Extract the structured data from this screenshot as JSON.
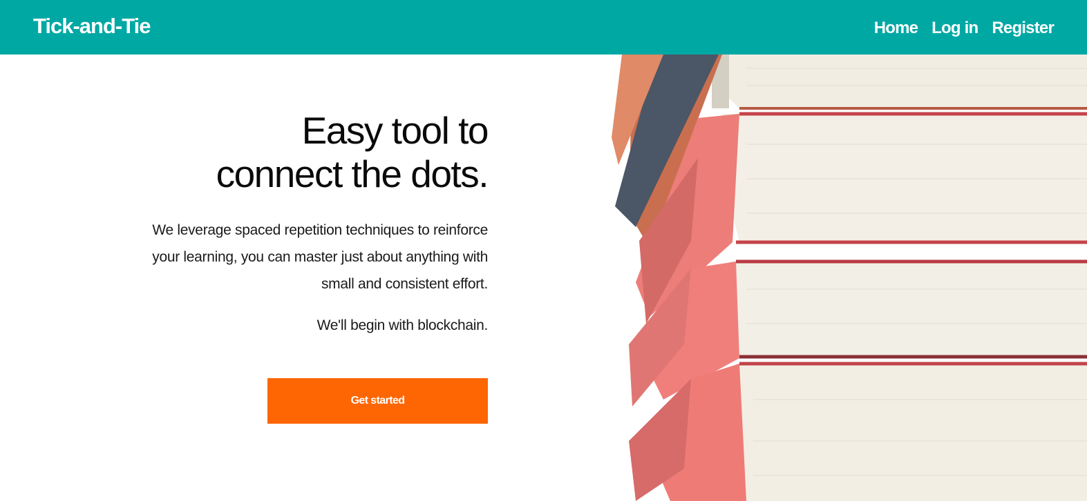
{
  "nav": {
    "brand": "Tick-and-Tie",
    "links": [
      "Home",
      "Log in",
      "Register"
    ]
  },
  "hero": {
    "headline_line1": "Easy tool to",
    "headline_line2": "connect the dots.",
    "lead": "We leverage spaced repetition techniques to reinforce your learning, you can master just about anything with small and consistent effort.",
    "sub": "We'll begin with blockchain.",
    "cta_label": "Get started"
  },
  "colors": {
    "navbar": "#00a8a4",
    "cta": "#fe6604"
  },
  "image": {
    "icon": "stacked-books-photo"
  }
}
